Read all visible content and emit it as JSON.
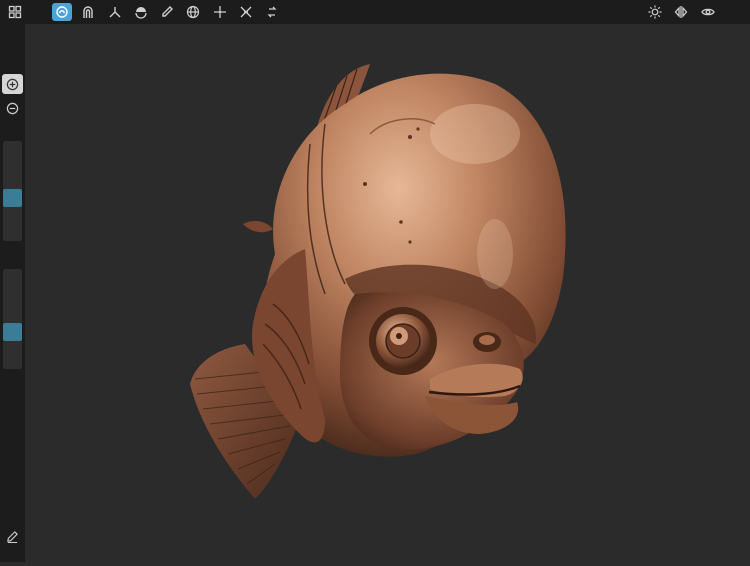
{
  "colors": {
    "toolbar_bg": "#1c1c1c",
    "canvas_bg": "#2b2b2b",
    "accent": "#4aa3d9",
    "slider_thumb": "#3c7c96",
    "icon": "#cfcfcf",
    "model": "#b67a58"
  },
  "toolbar": {
    "left_tools": [
      "grid-icon",
      "clay-brush-icon",
      "crease-brush-icon",
      "move-brush-icon",
      "flatten-brush-icon",
      "paint-brush-icon",
      "sphere-icon",
      "transform-icon",
      "symmetry-icon",
      "more-tools-icon"
    ],
    "active_tool": "clay-brush-icon",
    "right_tools": [
      "lighting-icon",
      "mirror-icon",
      "visibility-icon"
    ]
  },
  "sidebar": {
    "add_mode": "add-icon",
    "subtract_mode": "subtract-icon",
    "radius_value": 0.41,
    "intensity_value": 0.34,
    "bottom_tool": "pencil-icon"
  }
}
